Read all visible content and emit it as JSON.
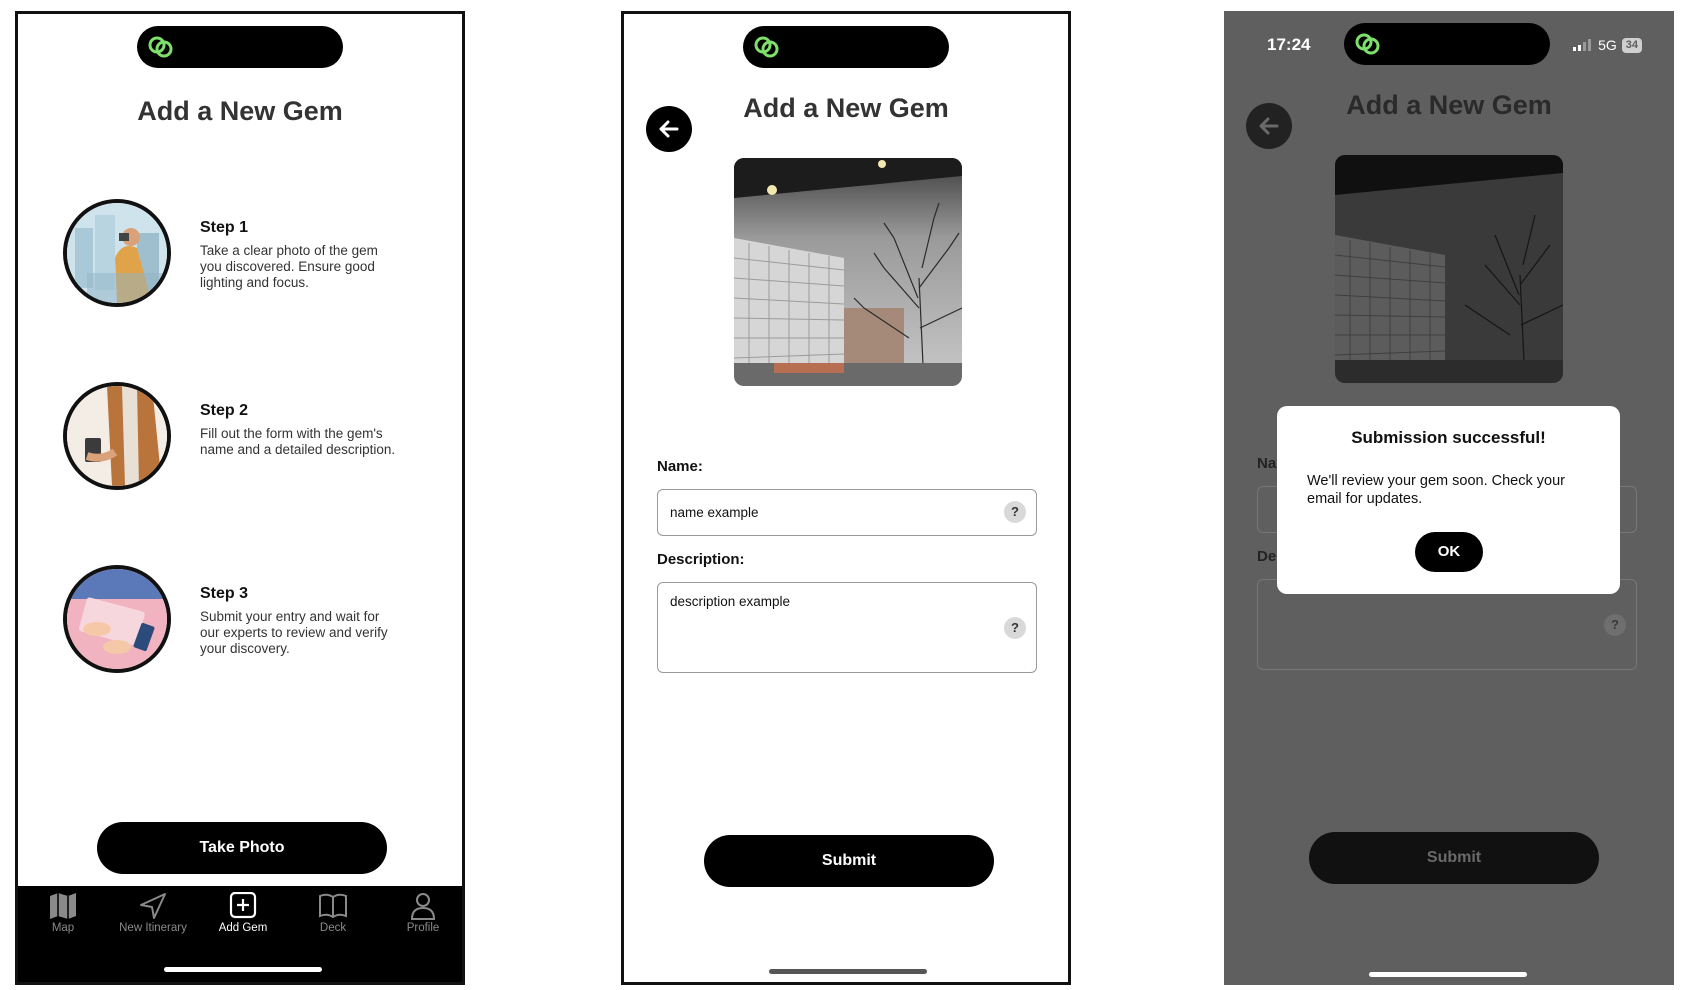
{
  "screen1": {
    "title": "Add a New Gem",
    "steps": [
      {
        "title": "Step 1",
        "text": "Take a clear photo of the gem you discovered. Ensure good lighting and focus."
      },
      {
        "title": "Step 2",
        "text": "Fill out the form with the gem's name and a detailed description."
      },
      {
        "title": "Step 3",
        "text": "Submit your entry and wait for our experts to review and verify your discovery."
      }
    ],
    "take_photo_label": "Take Photo",
    "tabs": [
      {
        "label": "Map",
        "icon": "map-icon"
      },
      {
        "label": "New Itinerary",
        "icon": "navigation-arrow-icon"
      },
      {
        "label": "Add Gem",
        "icon": "plus-square-icon",
        "active": true
      },
      {
        "label": "Deck",
        "icon": "open-book-icon"
      },
      {
        "label": "Profile",
        "icon": "person-icon"
      }
    ]
  },
  "screen2": {
    "title": "Add a New Gem",
    "name_label": "Name:",
    "name_value": "name example",
    "description_label": "Description:",
    "description_value": "description example",
    "help_symbol": "?",
    "submit_label": "Submit"
  },
  "screen3": {
    "status_time": "17:24",
    "network": "5G",
    "battery": "34",
    "title": "Add a New Gem",
    "name_label_partial": "Na",
    "description_label_partial": "De",
    "help_symbol": "?",
    "submit_label": "Submit",
    "modal": {
      "title": "Submission successful!",
      "text": "We'll review your gem soon. Check your email for updates.",
      "ok_label": "OK"
    }
  },
  "colors": {
    "accent_green": "#7ee06a",
    "dim_overlay": "#5f5f5f",
    "black": "#000000"
  }
}
